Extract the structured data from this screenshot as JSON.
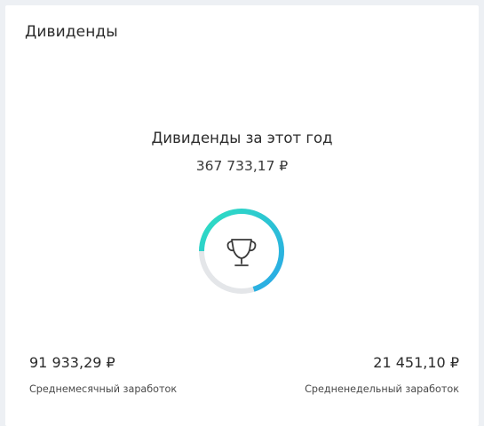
{
  "card": {
    "title": "Дивиденды"
  },
  "summary": {
    "title": "Дивиденды за этот год",
    "value": "367 733,17 ₽",
    "progress": 0.7,
    "colors": {
      "gradient_start": "#2aa7e8",
      "gradient_end": "#2ee0c0",
      "track": "#e4e6e9",
      "icon": "#3a3a3a"
    },
    "icon": "trophy-icon"
  },
  "stats": {
    "monthly": {
      "value": "91 933,29 ₽",
      "label": "Среднемесячный заработок"
    },
    "weekly": {
      "value": "21 451,10 ₽",
      "label": "Средненедельный заработок"
    }
  }
}
